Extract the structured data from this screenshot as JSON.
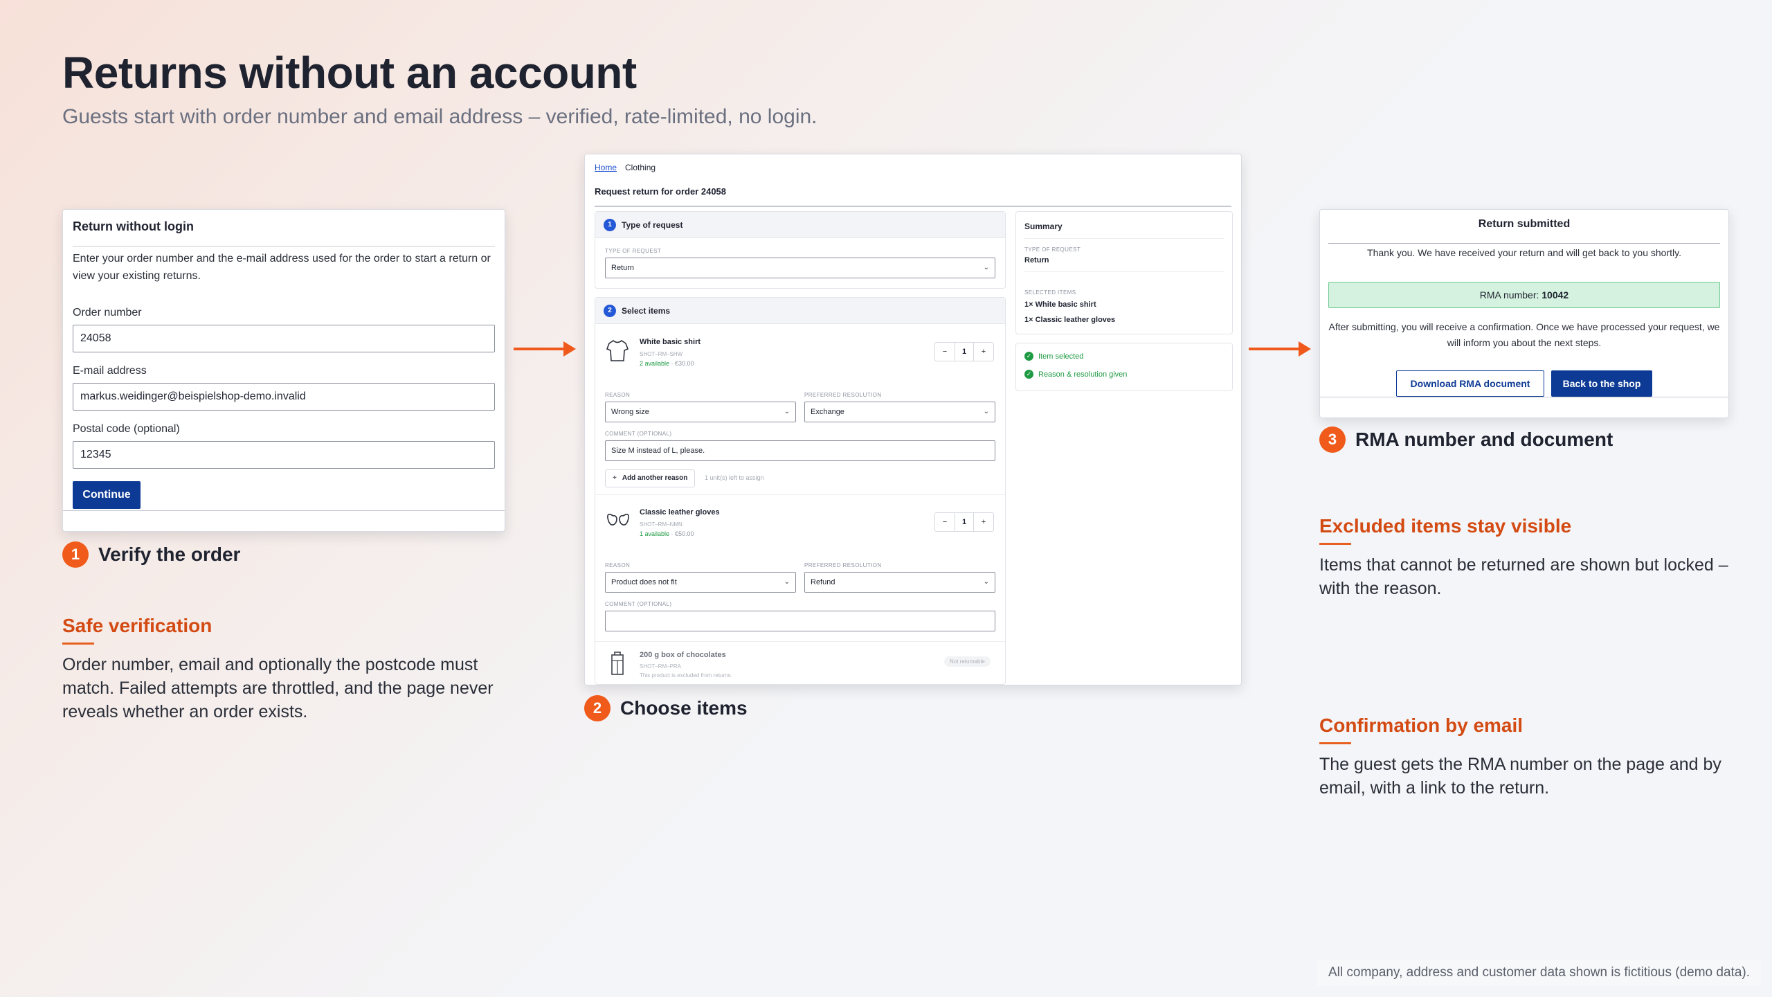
{
  "title": "Returns without an account",
  "subtitle": "Guests start with order number and email address – verified, rate-limited, no login.",
  "colors": {
    "accent": "#f05a1a",
    "primary_button": "#0d3a95",
    "success": "#1e9a43"
  },
  "login_card": {
    "heading": "Return without login",
    "intro": "Enter your order number and the e-mail address used for the order to start a return or view your existing returns.",
    "order_label": "Order number",
    "order_value": "24058",
    "email_label": "E-mail address",
    "email_value": "markus.weidinger@beispielshop-demo.invalid",
    "postal_label": "Postal code (optional)",
    "postal_value": "12345",
    "continue_label": "Continue"
  },
  "steps": [
    {
      "num": "1",
      "label": "Verify the order"
    },
    {
      "num": "2",
      "label": "Choose items"
    },
    {
      "num": "3",
      "label": "RMA number and document"
    }
  ],
  "features": {
    "safe": {
      "title": "Safe verification",
      "text": "Order number, email and optionally the postcode must match. Failed attempts are throttled, and the page never reveals whether an order exists."
    },
    "excluded": {
      "title": "Excluded items stay visible",
      "text": "Items that cannot be returned are shown but locked – with the reason."
    },
    "confirm": {
      "title": "Confirmation by email",
      "text": "The guest gets the RMA number on the page and by email, with a link to the return."
    }
  },
  "return_form": {
    "breadcrumbs": [
      "Home",
      "Clothing"
    ],
    "title": "Request return for order 24058",
    "section1": {
      "num": "1",
      "title": "Type of request",
      "field_label": "TYPE OF REQUEST",
      "value": "Return"
    },
    "section2": {
      "num": "2",
      "title": "Select items"
    },
    "items": [
      {
        "name": "White basic shirt",
        "sku": "SHOT–RM–SHW",
        "available": "2 available",
        "price": "· €30.00",
        "qty": "1",
        "reason_label": "REASON",
        "reason": "Wrong size",
        "resolution_label": "PREFERRED RESOLUTION",
        "resolution": "Exchange",
        "comment_label": "COMMENT (OPTIONAL)",
        "comment": "Size M instead of L, please.",
        "add_reason": "Add another reason",
        "unit_hint": "1 unit(s) left to assign"
      },
      {
        "name": "Classic leather gloves",
        "sku": "SHOT–RM–NMN",
        "available": "1 available",
        "price": "· €50.00",
        "qty": "1",
        "reason_label": "REASON",
        "reason": "Product does not fit",
        "resolution_label": "PREFERRED RESOLUTION",
        "resolution": "Refund",
        "comment_label": "COMMENT (OPTIONAL)",
        "comment": ""
      },
      {
        "name": "200 g box of chocolates",
        "sku": "SHOT–RM–PRA",
        "note": "This product is excluded from returns.",
        "badge": "Not returnable"
      }
    ],
    "summary": {
      "title": "Summary",
      "type_label": "TYPE OF REQUEST",
      "type_value": "Return",
      "selected_label": "SELECTED ITEMS",
      "selected": [
        "1× White basic shirt",
        "1× Classic leather gloves"
      ],
      "checks": [
        "Item selected",
        "Reason & resolution given"
      ]
    }
  },
  "confirmation": {
    "heading": "Return submitted",
    "thanks": "Thank you. We have received your return and will get back to you shortly.",
    "rma_label": "RMA number:",
    "rma_number": "10042",
    "info": "After submitting, you will receive a confirmation. Once we have processed your request, we will inform you about the next steps.",
    "download_label": "Download RMA document",
    "back_label": "Back to the shop"
  },
  "footer_note": "All company, address and customer data shown is fictitious (demo data)."
}
